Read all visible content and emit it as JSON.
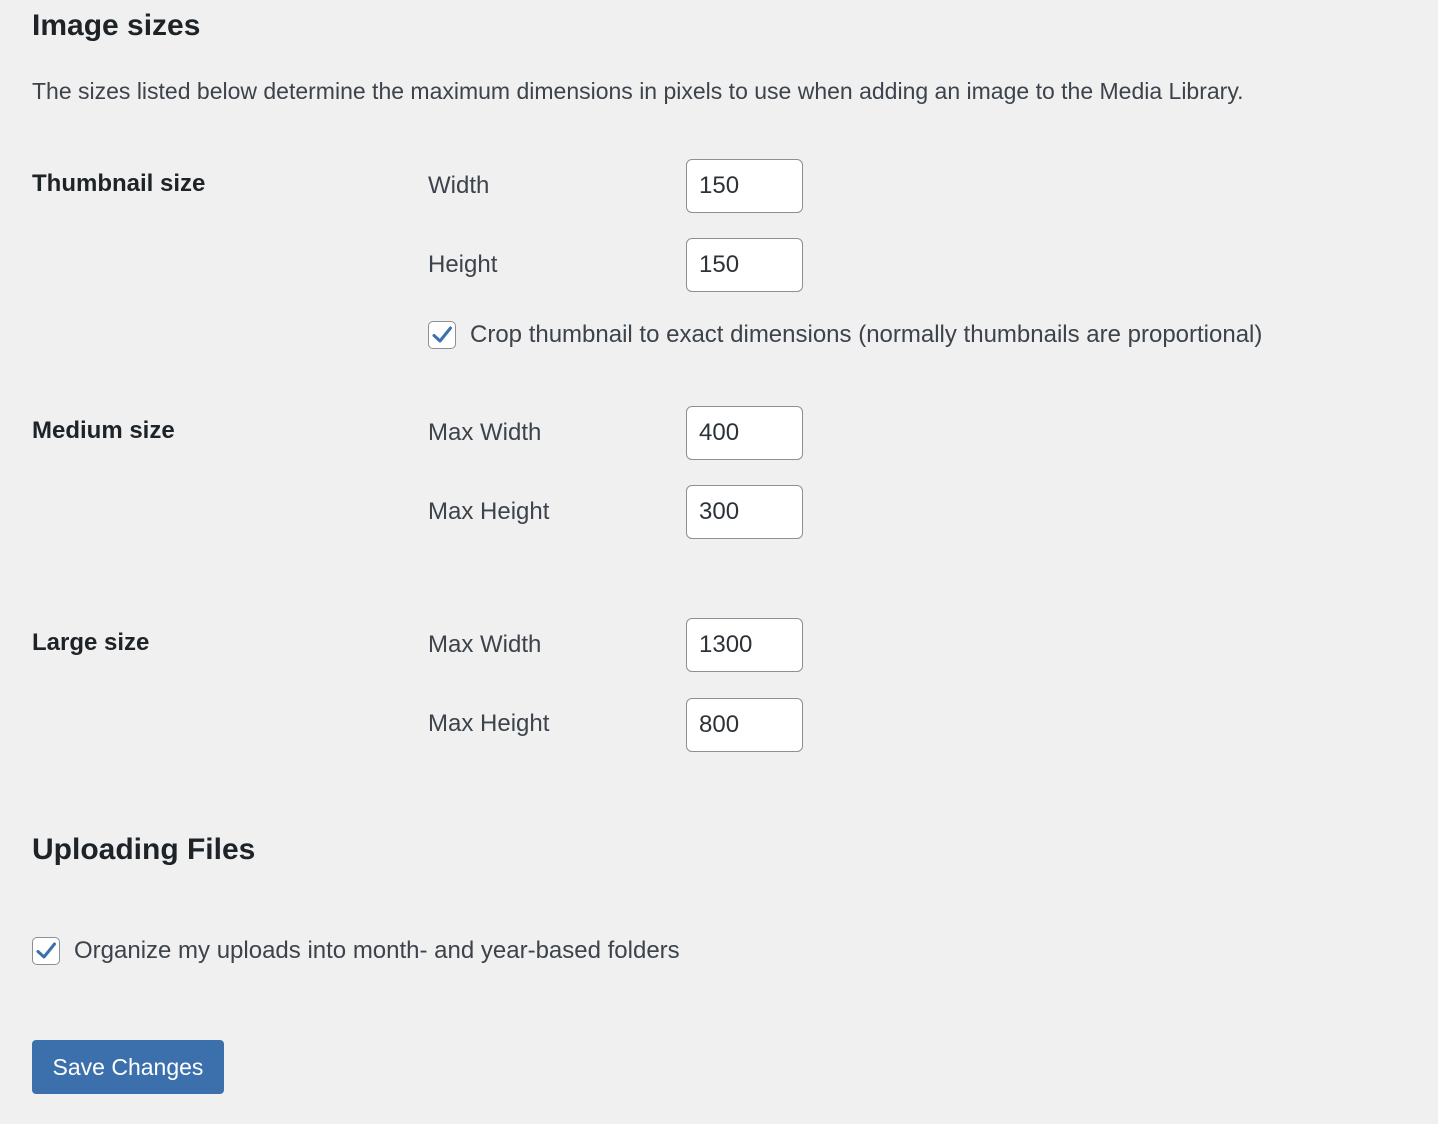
{
  "image_sizes": {
    "heading": "Image sizes",
    "description": "The sizes listed below determine the maximum dimensions in pixels to use when adding an image to the Media Library."
  },
  "thumbnail": {
    "label": "Thumbnail size",
    "width_label": "Width",
    "width_value": "150",
    "height_label": "Height",
    "height_value": "150",
    "crop_label": "Crop thumbnail to exact dimensions (normally thumbnails are proportional)",
    "crop_checked": true
  },
  "medium": {
    "label": "Medium size",
    "width_label": "Max Width",
    "width_value": "400",
    "height_label": "Max Height",
    "height_value": "300"
  },
  "large": {
    "label": "Large size",
    "width_label": "Max Width",
    "width_value": "1300",
    "height_label": "Max Height",
    "height_value": "800"
  },
  "uploading": {
    "heading": "Uploading Files",
    "organize_label": "Organize my uploads into month- and year-based folders",
    "organize_checked": true
  },
  "actions": {
    "save_label": "Save Changes"
  },
  "colors": {
    "background": "#f0f0f1",
    "primary_button": "#3b70ad",
    "checkmark": "#3b70ad",
    "text": "#1d2327"
  }
}
